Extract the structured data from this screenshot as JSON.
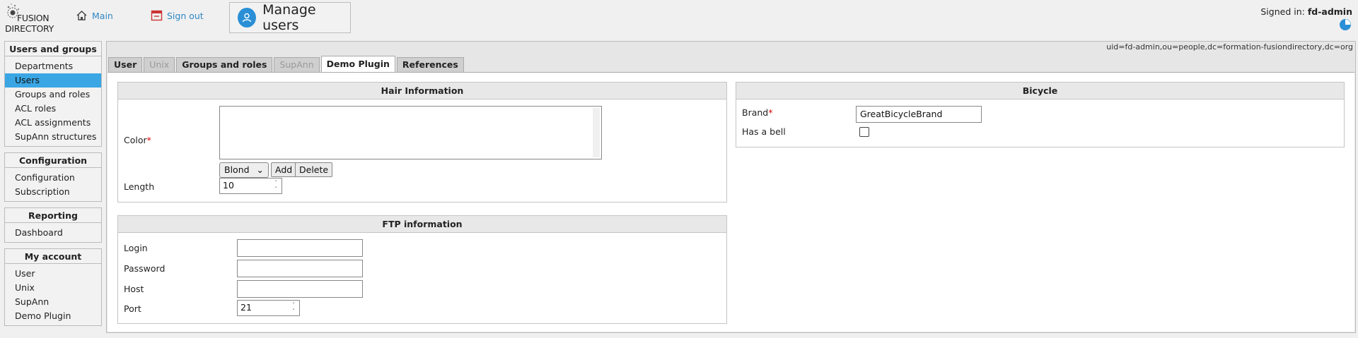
{
  "header": {
    "logo": {
      "line1": "FUSION",
      "line2": "DIRECTORY"
    },
    "nav": [
      {
        "label": "Main",
        "icon": "home-icon"
      },
      {
        "label": "Sign out",
        "icon": "logout-icon"
      }
    ],
    "page_title": "Manage users",
    "signed_in_label": "Signed in:",
    "signed_in_user": "fd-admin"
  },
  "sidebar": {
    "groups": [
      {
        "title": "Users and groups",
        "items": [
          "Departments",
          "Users",
          "Groups and roles",
          "ACL roles",
          "ACL assignments",
          "SupAnn structures"
        ],
        "selected": "Users"
      },
      {
        "title": "Configuration",
        "items": [
          "Configuration",
          "Subscription"
        ]
      },
      {
        "title": "Reporting",
        "items": [
          "Dashboard"
        ]
      },
      {
        "title": "My account",
        "items": [
          "User",
          "Unix",
          "SupAnn",
          "Demo Plugin"
        ]
      }
    ]
  },
  "main": {
    "dn": "uid=fd-admin,ou=people,dc=formation-fusiondirectory,dc=org",
    "tabs": [
      {
        "label": "User",
        "state": "normal"
      },
      {
        "label": "Unix",
        "state": "disabled"
      },
      {
        "label": "Groups and roles",
        "state": "normal"
      },
      {
        "label": "SupAnn",
        "state": "disabled"
      },
      {
        "label": "Demo Plugin",
        "state": "active"
      },
      {
        "label": "References",
        "state": "normal"
      }
    ],
    "hair": {
      "title": "Hair Information",
      "color_label": "Color",
      "color_select": "Blond",
      "add_label": "Add",
      "delete_label": "Delete",
      "length_label": "Length",
      "length_value": "10"
    },
    "ftp": {
      "title": "FTP information",
      "login_label": "Login",
      "password_label": "Password",
      "host_label": "Host",
      "port_label": "Port",
      "port_value": "21"
    },
    "bicycle": {
      "title": "Bicycle",
      "brand_label": "Brand",
      "brand_value": "GreatBicycleBrand",
      "bell_label": "Has a bell",
      "bell_checked": false
    }
  }
}
